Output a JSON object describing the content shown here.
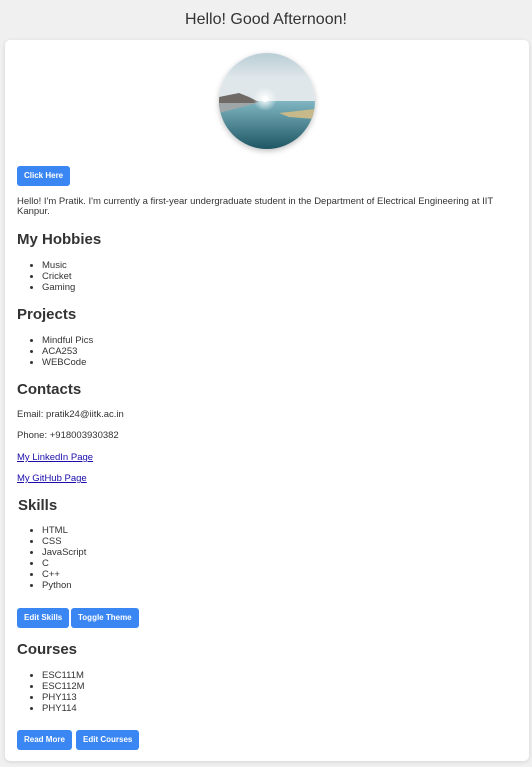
{
  "header": {
    "greeting": "Hello! Good Afternoon!"
  },
  "profile": {
    "avatar_alt": "profile-photo",
    "click_here_label": "Click Here",
    "intro": "Hello! I'm Pratik. I'm currently a first-year undergraduate student in the Department of Electrical Engineering at IIT Kanpur."
  },
  "hobbies": {
    "title": "My Hobbies",
    "items": [
      "Music",
      "Cricket",
      "Gaming"
    ]
  },
  "projects": {
    "title": "Projects",
    "items": [
      "Mindful Pics",
      "ACA253",
      "WEBCode"
    ]
  },
  "contacts": {
    "title": "Contacts",
    "email": "Email: pratik24@iitk.ac.in",
    "phone": "Phone: +918003930382",
    "linkedin_label": "My LinkedIn Page",
    "github_label": "My GitHub Page"
  },
  "skills": {
    "title": "Skills",
    "items": [
      "HTML",
      "CSS",
      "JavaScript",
      "C",
      "C++",
      "Python"
    ],
    "edit_label": "Edit Skills",
    "toggle_theme_label": "Toggle Theme"
  },
  "courses": {
    "title": "Courses",
    "items": [
      "ESC111M",
      "ESC112M",
      "PHY113",
      "PHY114"
    ],
    "read_more_label": "Read More",
    "edit_label": "Edit Courses"
  },
  "colors": {
    "accent": "#3a86f2",
    "background": "#f0f0f0",
    "card": "#ffffff",
    "link": "#1a0dab"
  }
}
